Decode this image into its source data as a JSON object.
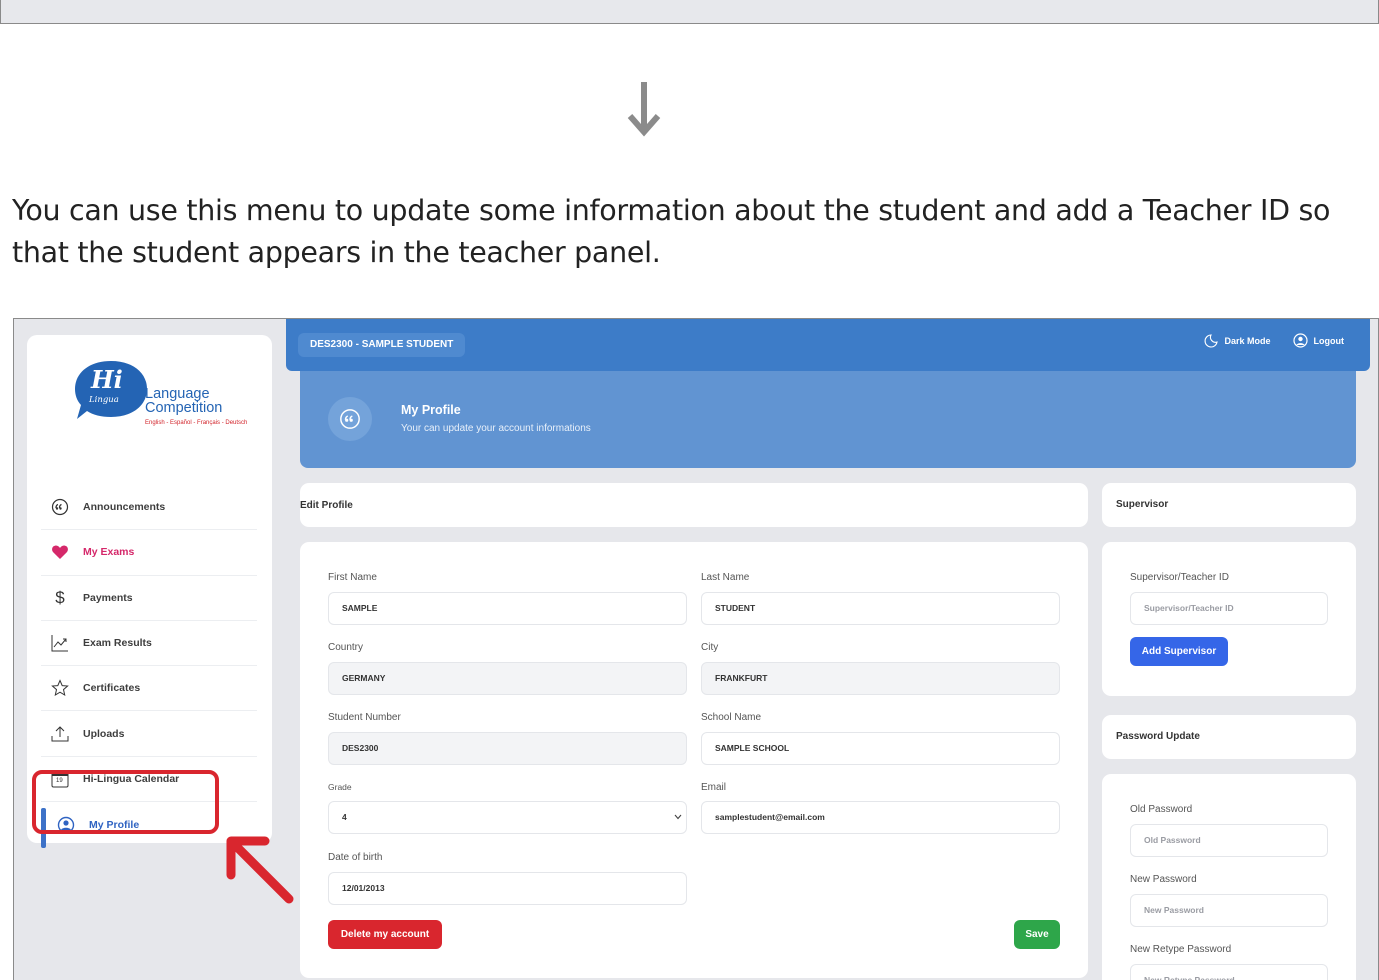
{
  "instruction": "You can use this menu to update some information about the student and add a Teacher ID so that the student appears in the teacher panel.",
  "logo": {
    "mark": "Hi",
    "mark_sub": "Lingua",
    "line1": "Language",
    "line2": "Competition",
    "languages": "English - Español - Français - Deutsch"
  },
  "sidebar": {
    "items": [
      {
        "label": "Announcements",
        "icon": "announcement-icon"
      },
      {
        "label": "My Exams",
        "icon": "heart-icon"
      },
      {
        "label": "Payments",
        "icon": "dollar-icon"
      },
      {
        "label": "Exam Results",
        "icon": "chart-icon"
      },
      {
        "label": "Certificates",
        "icon": "star-icon"
      },
      {
        "label": "Uploads",
        "icon": "upload-icon"
      },
      {
        "label": "Hi-Lingua Calendar",
        "icon": "calendar-icon",
        "calendar_day": "19"
      },
      {
        "label": "My Profile",
        "icon": "user-icon",
        "active": true
      }
    ]
  },
  "topbar": {
    "student_id": "DES2300 - SAMPLE STUDENT",
    "dark_mode": "Dark Mode",
    "logout": "Logout"
  },
  "banner": {
    "title": "My Profile",
    "subtitle": "Your can update your account informations"
  },
  "edit_profile": {
    "title": "Edit Profile",
    "first_name": {
      "label": "First Name",
      "value": "SAMPLE"
    },
    "last_name": {
      "label": "Last Name",
      "value": "STUDENT"
    },
    "country": {
      "label": "Country",
      "value": "GERMANY"
    },
    "city": {
      "label": "City",
      "value": "FRANKFURT"
    },
    "student_number": {
      "label": "Student Number",
      "value": "DES2300"
    },
    "school_name": {
      "label": "School Name",
      "value": "SAMPLE SCHOOL"
    },
    "grade": {
      "label": "Grade",
      "value": "4"
    },
    "email": {
      "label": "Email",
      "value": "samplestudent@email.com"
    },
    "dob": {
      "label": "Date of birth",
      "value": "12/01/2013"
    },
    "delete_label": "Delete my account",
    "save_label": "Save"
  },
  "supervisor": {
    "title": "Supervisor",
    "field_label": "Supervisor/Teacher ID",
    "placeholder": "Supervisor/Teacher ID",
    "button": "Add Supervisor"
  },
  "password": {
    "title": "Password Update",
    "old_label": "Old Password",
    "old_placeholder": "Old Password",
    "new_label": "New Password",
    "new_placeholder": "New Password",
    "retype_label": "New Retype Password",
    "retype_placeholder": "New Retype Password"
  },
  "colors": {
    "brand_blue": "#3d7cc8",
    "banner_blue": "#6194d2",
    "danger": "#d9262e",
    "save_green": "#2ea64a",
    "add_blue": "#3566e8",
    "highlight_red": "#d9262e"
  }
}
